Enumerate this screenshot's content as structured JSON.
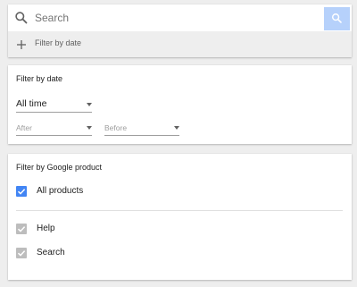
{
  "search": {
    "placeholder": "Search",
    "filter_toggle_label": "Filter by date"
  },
  "date_filter": {
    "title": "Filter by date",
    "range_value": "All time",
    "after_label": "After",
    "before_label": "Before"
  },
  "product_filter": {
    "title": "Filter by Google product",
    "items": [
      {
        "label": "All products",
        "checked": true,
        "enabled": true
      },
      {
        "label": "Help",
        "checked": true,
        "enabled": false
      },
      {
        "label": "Search",
        "checked": true,
        "enabled": false
      }
    ]
  },
  "colors": {
    "accent": "#4285f4",
    "search_button": "#b6d1fb",
    "disabled_check": "#bdbdbd",
    "background": "#eeeeee"
  }
}
